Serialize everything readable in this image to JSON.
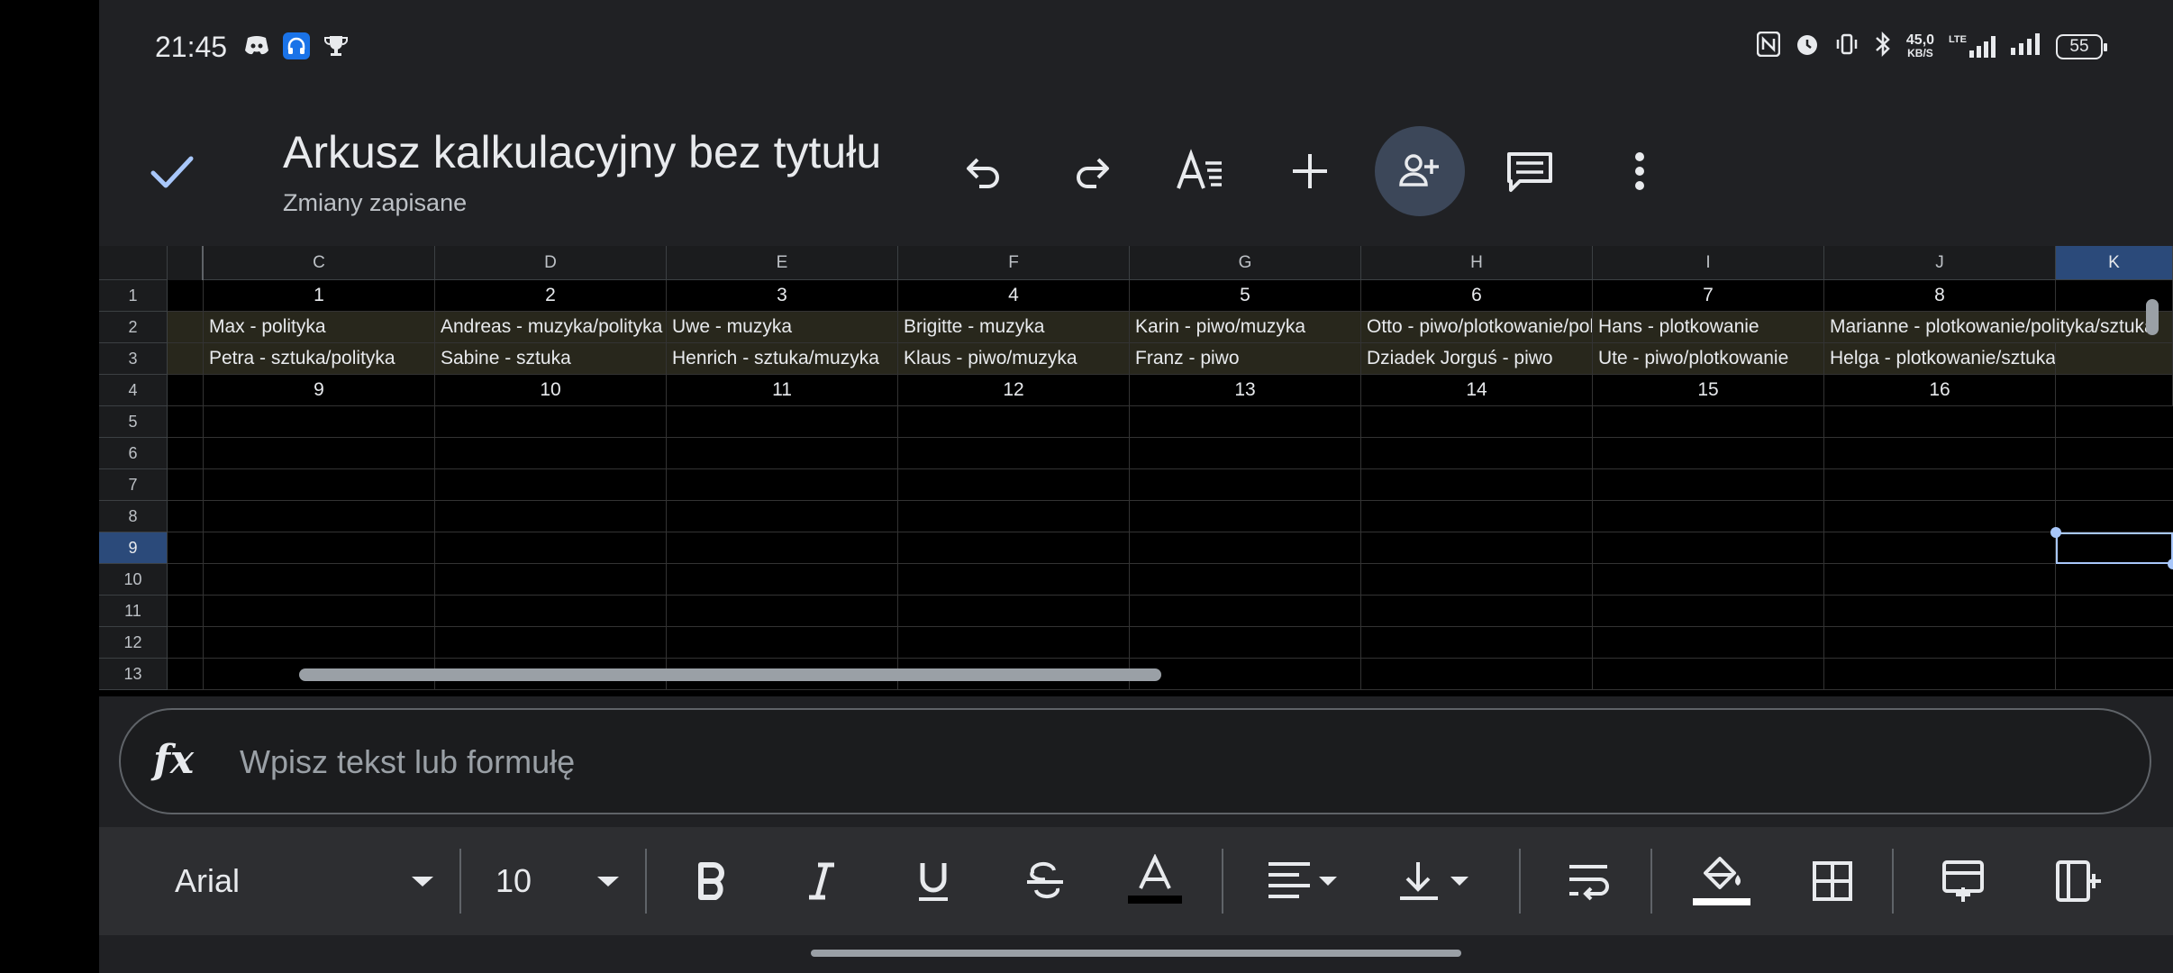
{
  "status_bar": {
    "time": "21:45",
    "net_speed_value": "45,0",
    "net_speed_unit": "KB/S",
    "net_type": "LTE",
    "battery": "55"
  },
  "header": {
    "title": "Arkusz kalkulacyjny bez tytułu",
    "subtitle": "Zmiany zapisane"
  },
  "grid": {
    "columns": [
      "C",
      "D",
      "E",
      "F",
      "G",
      "H",
      "I",
      "J",
      "K"
    ],
    "selected_column": "K",
    "rows": [
      "1",
      "2",
      "3",
      "4",
      "5",
      "6",
      "7",
      "8",
      "9",
      "10",
      "11",
      "12",
      "13"
    ],
    "selected_row": "9",
    "row1": [
      "1",
      "2",
      "3",
      "4",
      "5",
      "6",
      "7",
      "8"
    ],
    "row2": [
      "Max - polityka",
      "Andreas - muzyka/polityka",
      "Uwe - muzyka",
      "Brigitte - muzyka",
      "Karin - piwo/muzyka",
      "Otto - piwo/plotkowanie/polityka",
      "Hans - plotkowanie",
      "Marianne - plotkowanie/polityka/sztuka"
    ],
    "row3": [
      "Petra - sztuka/polityka",
      "Sabine - sztuka",
      "Henrich - sztuka/muzyka",
      "Klaus - piwo/muzyka",
      "Franz - piwo",
      "Dziadek Jorguś - piwo",
      "Ute - piwo/plotkowanie",
      "Helga - plotkowanie/sztuka"
    ],
    "row4": [
      "9",
      "10",
      "11",
      "12",
      "13",
      "14",
      "15",
      "16"
    ]
  },
  "formula_bar": {
    "fx_label": "fx",
    "placeholder": "Wpisz tekst lub formułę"
  },
  "toolbar": {
    "font": "Arial",
    "size": "10"
  },
  "colors": {
    "background": "#202124",
    "grid_bg": "#000000",
    "highlight_row": "#28271c",
    "selection": "#a8c7fa",
    "share_button": "#3c4759"
  }
}
